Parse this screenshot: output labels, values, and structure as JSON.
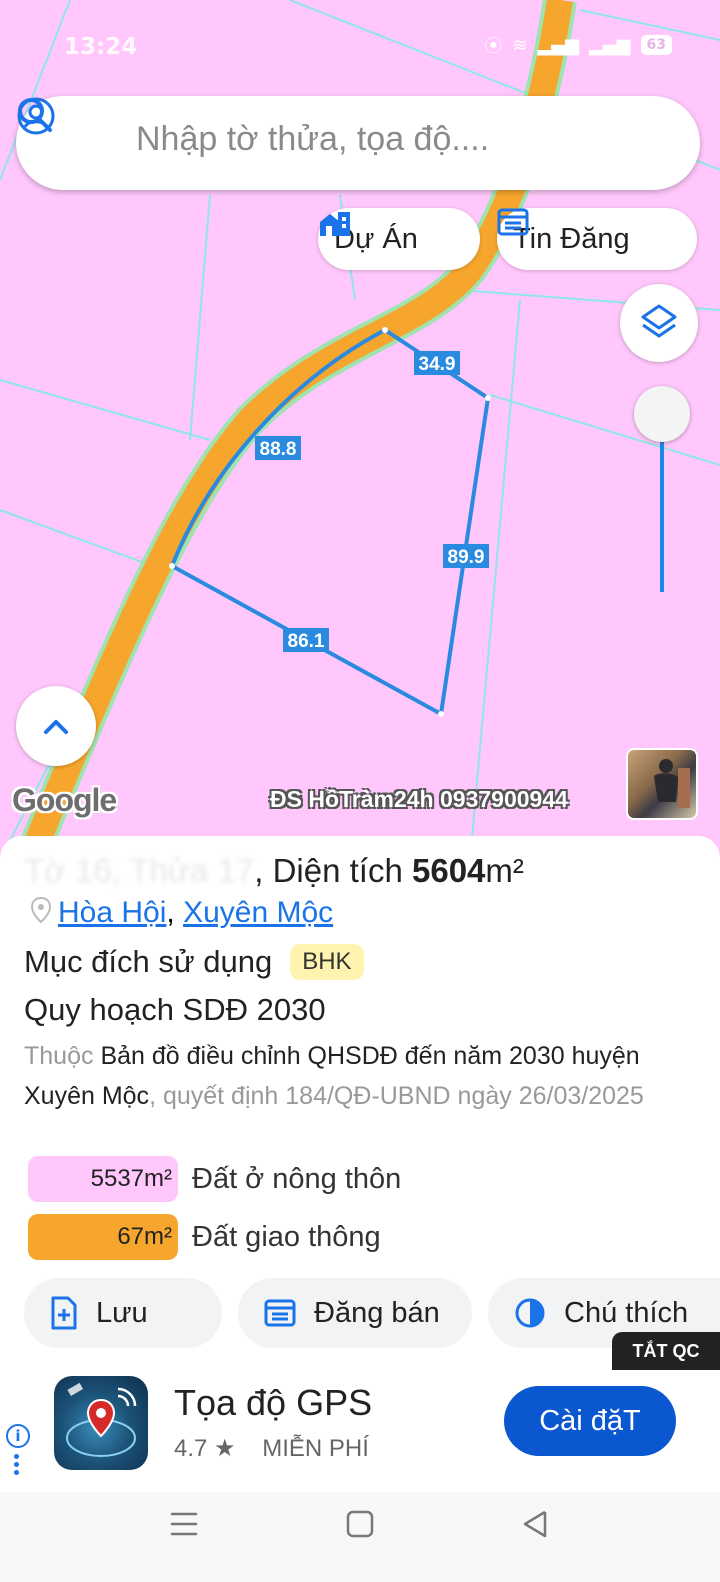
{
  "status": {
    "time": "13:24",
    "battery": "63"
  },
  "search": {
    "placeholder": "Nhập tờ thửa, tọa độ...."
  },
  "chips": {
    "du_an": "Dự Án",
    "tin_dang": "Tin Đăng"
  },
  "map": {
    "edges": [
      {
        "label": "34.9"
      },
      {
        "label": "88.8"
      },
      {
        "label": "89.9"
      },
      {
        "label": "86.1"
      }
    ],
    "google": "Google",
    "watermark": "ĐS HồTràm24h 0937900944"
  },
  "parcel": {
    "title_hidden": "Tờ 16, Thửa 17",
    "area_prefix": ", Diện tích ",
    "area_value": "5604",
    "area_unit": "m²",
    "commune": "Hòa Hội",
    "separator": ",",
    "district": "Xuyên Mộc",
    "purpose_label": "Mục đích sử dụng",
    "purpose_code": "BHK",
    "plan_title": "Quy hoạch SDĐ 2030",
    "plan_desc_1": "Thuộc ",
    "plan_desc_2": "Bản đồ điều chỉnh QHSDĐ đến năm 2030 huyện Xuyên Mộc",
    "plan_desc_3": ", quyết định 184/QĐ-UBND ngày 26/03/2025",
    "land_uses": [
      {
        "area": "5537m²",
        "label": "Đất ở nông thôn",
        "color": "#ffc7fb"
      },
      {
        "area": "67m²",
        "label": "Đất giao thông",
        "color": "#f7a62d"
      }
    ]
  },
  "actions": {
    "save": "Lưu",
    "post": "Đăng bán",
    "legend": "Chú thích"
  },
  "ad": {
    "close_label": "TẮT QC",
    "app_name": "Tọa độ GPS",
    "rating": "4.7 ★",
    "price": "MIỄN PHÍ",
    "install": "Cài đặT"
  },
  "colors": {
    "map_bg": "#ffc7fb",
    "road": "#f7a62d",
    "parcel_line": "#2a8ae0",
    "accent": "#1a73e8"
  }
}
